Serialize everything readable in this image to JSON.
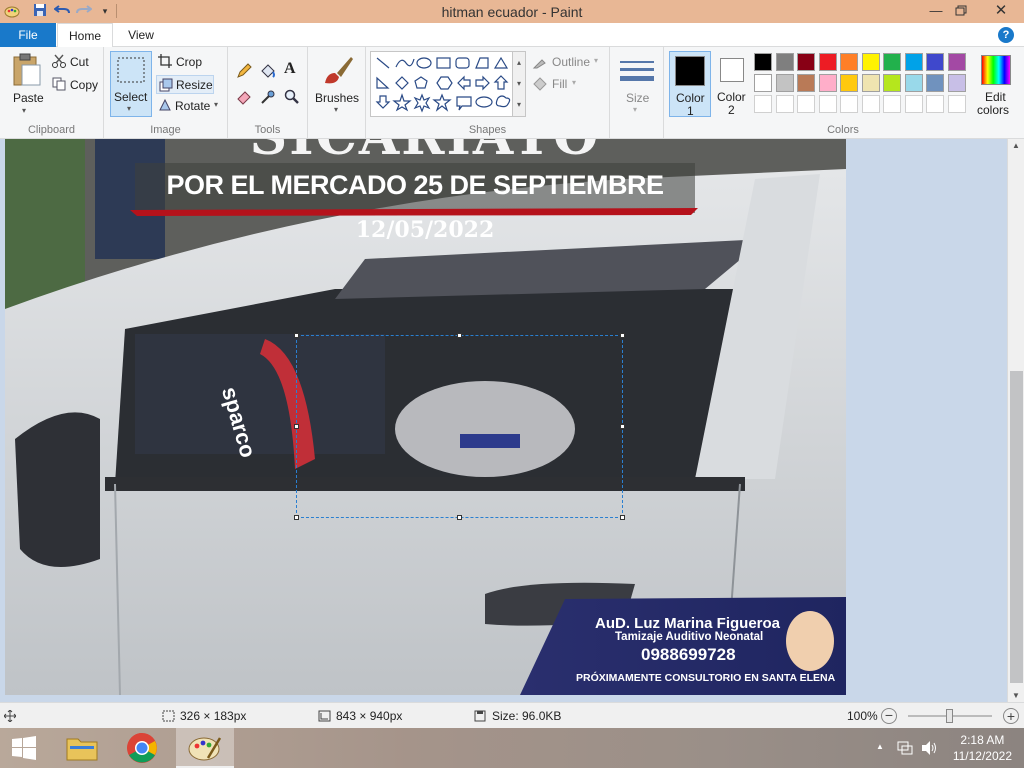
{
  "window": {
    "title": "hitman ecuador - Paint"
  },
  "tabs": [
    "File",
    "Home",
    "View"
  ],
  "ribbon": {
    "clipboard": {
      "paste": "Paste",
      "cut": "Cut",
      "copy": "Copy",
      "label": "Clipboard"
    },
    "image": {
      "select": "Select",
      "crop": "Crop",
      "resize": "Resize",
      "rotate": "Rotate",
      "label": "Image"
    },
    "tools": {
      "label": "Tools"
    },
    "brushes": {
      "label": "Brushes"
    },
    "shapes": {
      "outline": "Outline",
      "fill": "Fill",
      "label": "Shapes"
    },
    "size": {
      "label": "Size"
    },
    "color1": {
      "line1": "Color",
      "line2": "1",
      "value": "#000000"
    },
    "color2": {
      "line1": "Color",
      "line2": "2",
      "value": "#ffffff"
    },
    "edit_colors": {
      "line1": "Edit",
      "line2": "colors"
    },
    "colors_label": "Colors",
    "palette_row1": [
      "#000000",
      "#7f7f7f",
      "#880015",
      "#ed1c24",
      "#ff7f27",
      "#fff200",
      "#22b14c",
      "#00a2e8",
      "#3f48cc",
      "#a349a4"
    ],
    "palette_row2": [
      "#ffffff",
      "#c3c3c3",
      "#b97a57",
      "#ffaec9",
      "#ffc90e",
      "#efe4b0",
      "#b5e61d",
      "#99d9ea",
      "#7092be",
      "#c8bfe7"
    ]
  },
  "image_content": {
    "headline_partial": "SICARIATO",
    "subheadline": "POR EL MERCADO 25 DE SEPTIEMBRE",
    "date": "12/05/2022",
    "steering_text": "sparco",
    "ad_name": "AuD. Luz Marina Figueroa",
    "ad_subtitle": "Tamizaje Auditivo Neonatal",
    "ad_phone": "0988699728",
    "ad_footer": "PRÓXIMAMENTE CONSULTORIO EN SANTA ELENA"
  },
  "status": {
    "selection_size": "326 × 183px",
    "image_size": "843 × 940px",
    "file_size": "Size: 96.0KB",
    "zoom": "100%",
    "zoom_fraction": 0.5
  },
  "taskbar": {
    "time": "2:18 AM",
    "date": "11/12/2022"
  }
}
